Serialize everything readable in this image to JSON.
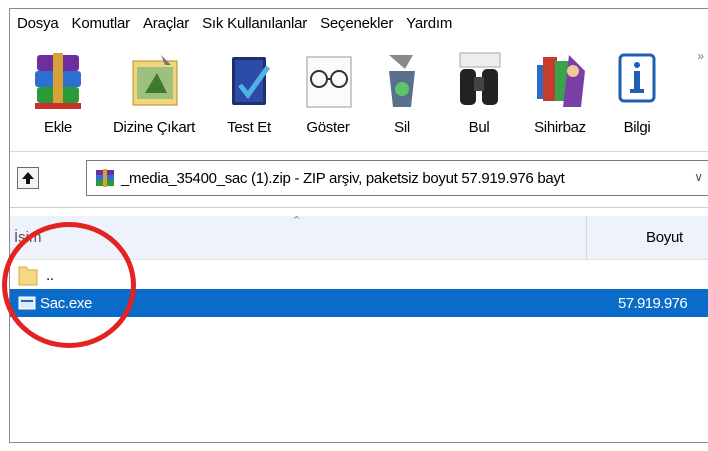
{
  "menu": {
    "items": [
      {
        "label": "Dosya"
      },
      {
        "label": "Komutlar"
      },
      {
        "label": "Araçlar"
      },
      {
        "label": "Sık Kullanılanlar"
      },
      {
        "label": "Seçenekler"
      },
      {
        "label": "Yardım"
      }
    ]
  },
  "toolbar": {
    "add": "Ekle",
    "extract": "Dizine Çıkart",
    "test": "Test Et",
    "view": "Göster",
    "delete": "Sil",
    "find": "Bul",
    "wizard": "Sihirbaz",
    "info": "Bilgi",
    "more": "»"
  },
  "path": {
    "text": "_media_35400_sac (1).zip - ZIP arşiv, paketsiz boyut 57.919.976 bayt"
  },
  "columns": {
    "name": "İsim",
    "size": "Boyut"
  },
  "files": [
    {
      "name": "..",
      "size": "",
      "type": "folder"
    },
    {
      "name": "Sac.exe",
      "size": "57.919.976",
      "type": "exe",
      "selected": true
    }
  ],
  "colors": {
    "selection": "#0a6bc9",
    "highlight_circle": "#e32222",
    "header_bg": "#eef3fb"
  }
}
